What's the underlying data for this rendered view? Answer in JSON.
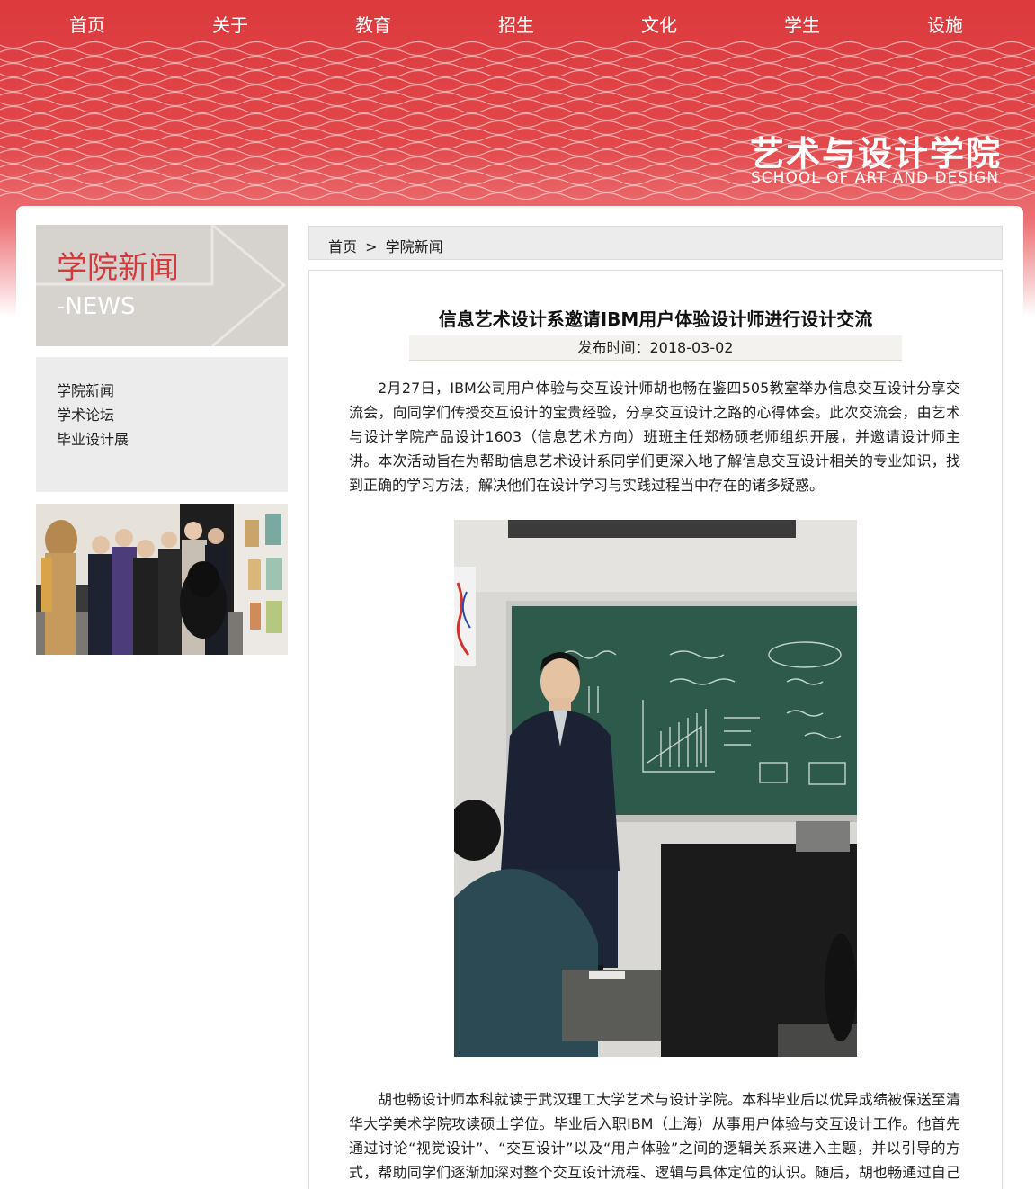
{
  "nav": {
    "items": [
      {
        "label": "首页"
      },
      {
        "label": "关于"
      },
      {
        "label": "教育"
      },
      {
        "label": "招生"
      },
      {
        "label": "文化"
      },
      {
        "label": "学生"
      },
      {
        "label": "设施"
      }
    ]
  },
  "brand": {
    "name_cn": "艺术与设计学院",
    "name_en": "SCHOOL OF ART AND DESIGN"
  },
  "sidebar": {
    "title_cn": "学院新闻",
    "title_en": "-NEWS",
    "items": [
      {
        "label": "学院新闻"
      },
      {
        "label": "学术论坛"
      },
      {
        "label": "毕业设计展"
      }
    ]
  },
  "breadcrumb": {
    "home": "首页",
    "separator": ">",
    "current": "学院新闻"
  },
  "article": {
    "title": "信息艺术设计系邀请IBM用户体验设计师进行设计交流",
    "date": "发布时间：2018-03-02",
    "paragraph1": "2月27日，IBM公司用户体验与交互设计师胡也畅在鉴四505教室举办信息交互设计分享交流会，向同学们传授交互设计的宝贵经验，分享交互设计之路的心得体会。此次交流会，由艺术与设计学院产品设计1603（信息艺术方向）班班主任郑杨硕老师组织开展，并邀请设计师主讲。本次活动旨在为帮助信息艺术设计系同学们更深入地了解信息交互设计相关的专业知识，找到正确的学习方法，解决他们在设计学习与实践过程当中存在的诸多疑惑。",
    "paragraph2": "胡也畅设计师本科就读于武汉理工大学艺术与设计学院。本科毕业后以优异成绩被保送至清华大学美术学院攻读硕士学位。毕业后入职IBM（上海）从事用户体验与交互设计工作。他首先通过讨论“视觉设计”、“交互设计”以及“用户体验”之间的逻辑关系来进入主题，并以引导的方式，帮助同学们逐渐加深对整个交互设计流程、逻辑与具体定位的认识。随后，胡也畅通过自己多"
  },
  "colors": {
    "brand_red": "#dc3a3d",
    "sidebar_title_red": "#d33a3c",
    "panel_gray": "#ececec"
  }
}
